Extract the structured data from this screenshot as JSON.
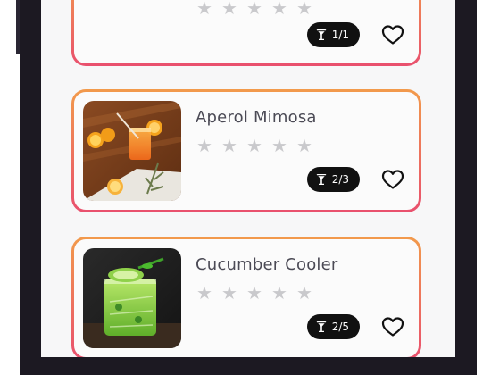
{
  "cards": [
    {
      "title": "",
      "rating": 0,
      "stars": [
        "★",
        "★",
        "★",
        "★",
        "★"
      ],
      "badge": "1/1",
      "badge_icon": "cocktail-glass-icon",
      "favorite_icon": "heart-outline-icon"
    },
    {
      "title": "Aperol Mimosa",
      "rating": 0,
      "stars": [
        "★",
        "★",
        "★",
        "★",
        "★"
      ],
      "badge": "2/3",
      "badge_icon": "cocktail-glass-icon",
      "favorite_icon": "heart-outline-icon"
    },
    {
      "title": "Cucumber Cooler",
      "rating": 0,
      "stars": [
        "★",
        "★",
        "★",
        "★",
        "★"
      ],
      "badge": "2/5",
      "badge_icon": "cocktail-glass-icon",
      "favorite_icon": "heart-outline-icon"
    }
  ],
  "colors": {
    "card_border_top": "#f29a4b",
    "card_border_bottom": "#e9506e",
    "star_empty": "#c9c9cc",
    "badge_bg": "#111111",
    "title_text": "#4b4a55"
  }
}
